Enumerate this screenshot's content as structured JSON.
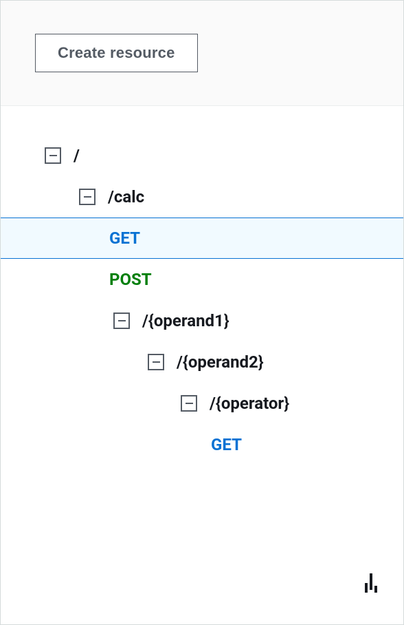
{
  "header": {
    "create_button": "Create resource"
  },
  "tree": {
    "root": {
      "label": "/"
    },
    "calc": {
      "label": "/calc"
    },
    "calc_get": {
      "label": "GET"
    },
    "calc_post": {
      "label": "POST"
    },
    "operand1": {
      "label": "/{operand1}"
    },
    "operand2": {
      "label": "/{operand2}"
    },
    "operator": {
      "label": "/{operator}"
    },
    "operator_get": {
      "label": "GET"
    }
  }
}
